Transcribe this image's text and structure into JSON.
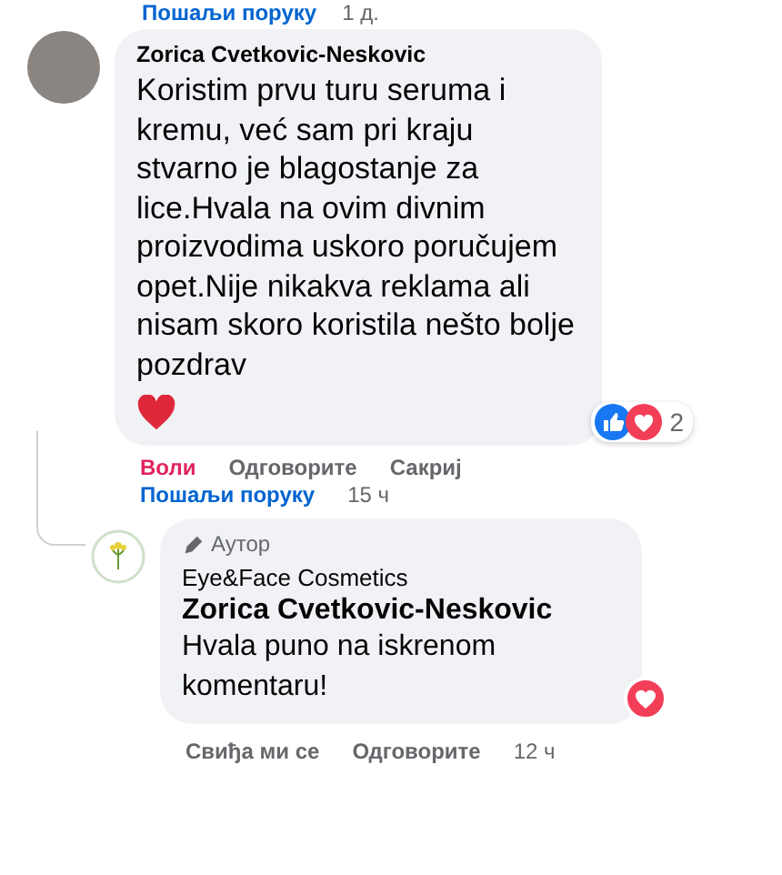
{
  "top_actions": {
    "link": "Пошаљи поруку",
    "time": "1 д."
  },
  "comment": {
    "author": "Zorica Cvetkovic-Neskovic",
    "text": "Koristim prvu turu seruma i kremu, već sam pri kraju stvarno je blagostanje za lice.Hvala na ovim divnim proizvodima uskoro poručujem opet.Nije nikakva reklama ali nisam skoro koristila nešto bolje pozdrav",
    "reactions_count": "2",
    "actions": [
      {
        "label": "Воли",
        "reacted": true
      },
      {
        "label": "Одговорите",
        "reacted": false
      },
      {
        "label": "Сакриј",
        "reacted": false
      }
    ],
    "message_link": "Пошаљи поруку",
    "time": "15 ч"
  },
  "reply": {
    "badge": "Аутор",
    "page": "Eye&Face Cosmetics",
    "mention": "Zorica Cvetkovic-Neskovic",
    "text": "Hvala puno na iskrenom komentaru!",
    "actions": [
      {
        "label": "Свиђа ми се",
        "reacted": false
      },
      {
        "label": "Одговорите",
        "reacted": false
      }
    ],
    "time": "12 ч"
  }
}
